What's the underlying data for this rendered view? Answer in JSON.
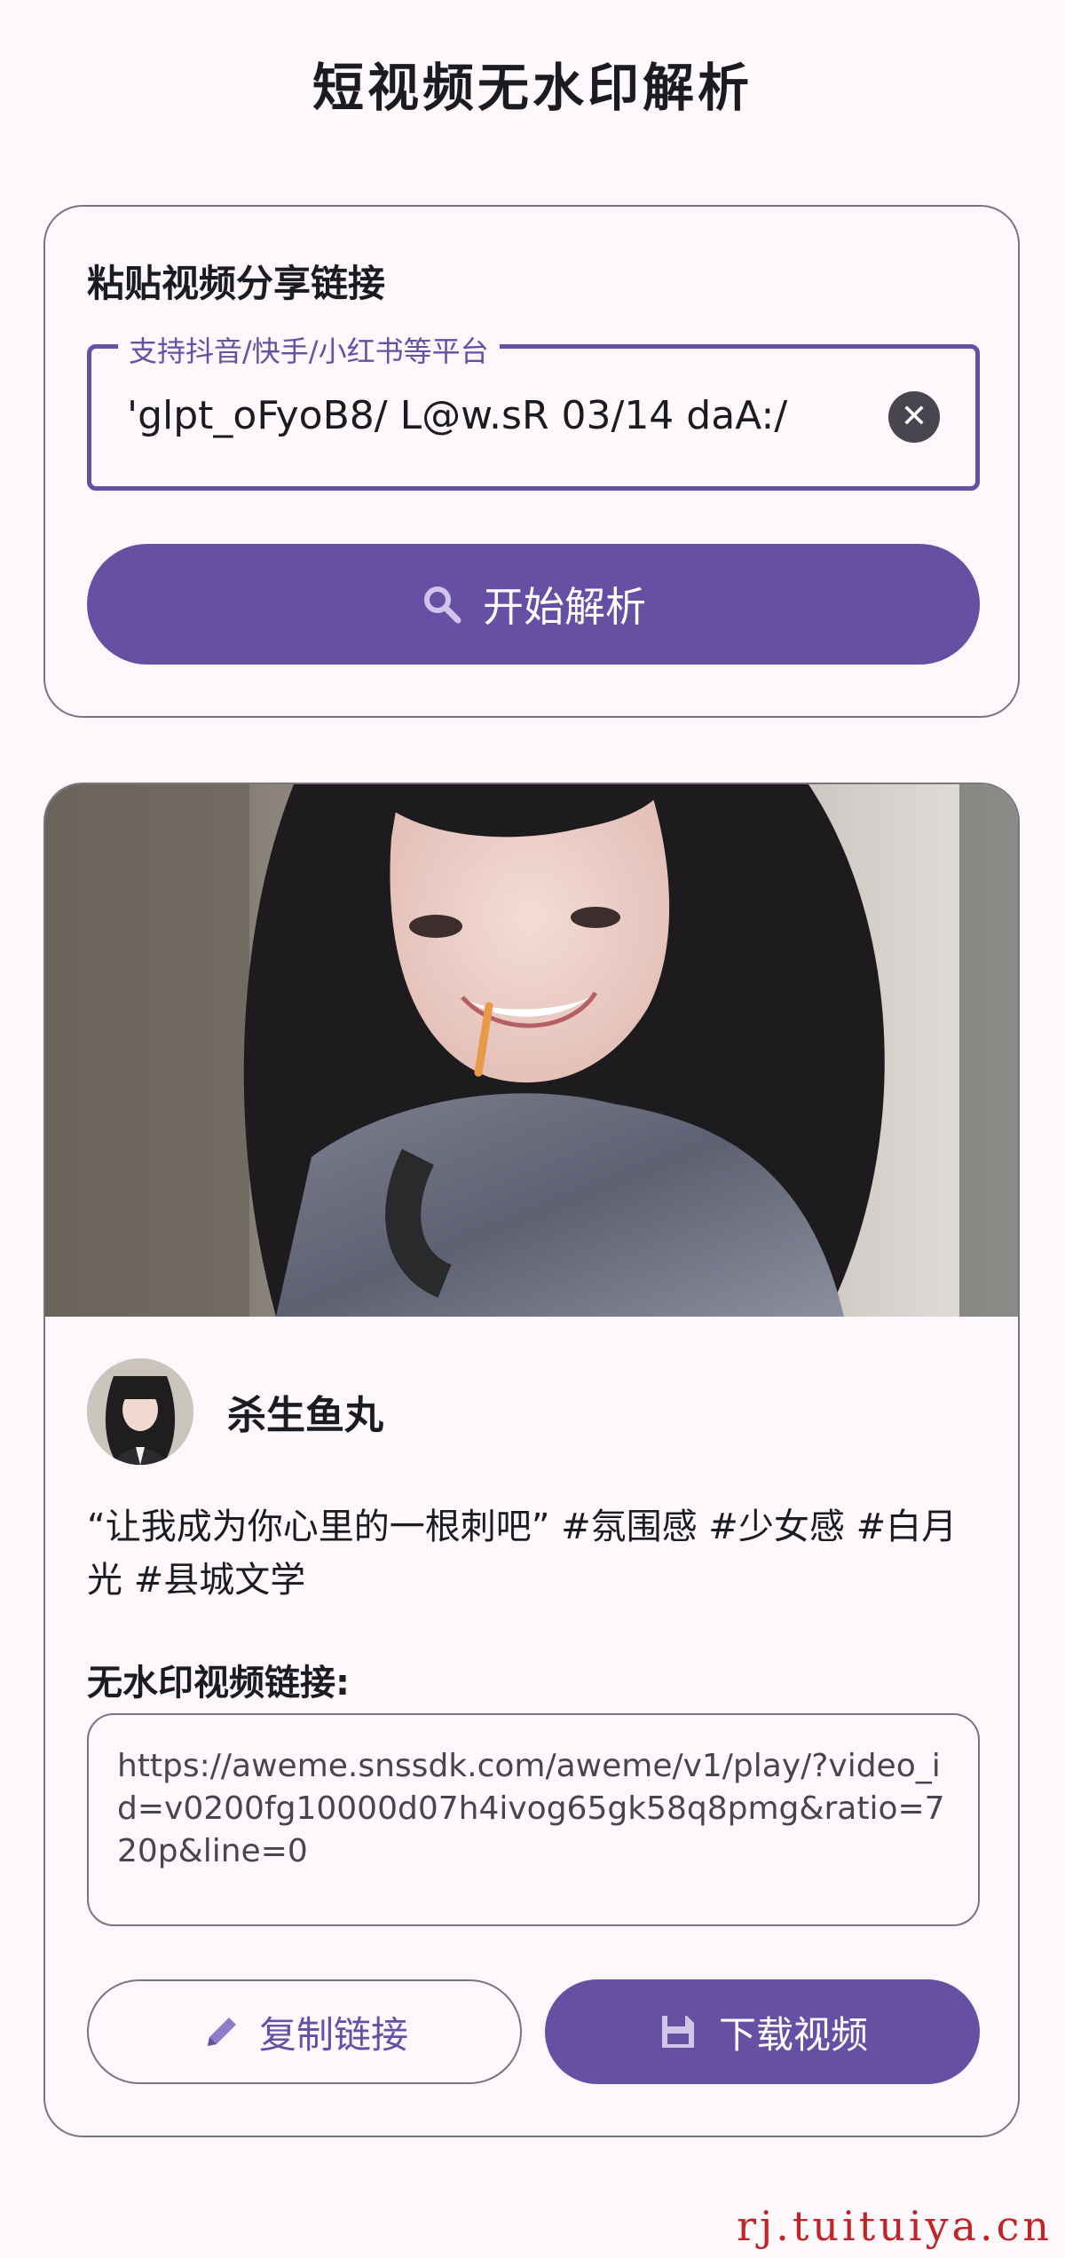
{
  "app": {
    "title": "短视频无水印解析"
  },
  "input_card": {
    "label": "粘贴视频分享链接",
    "field_label": "支持抖音/快手/小红书等平台",
    "field_value": "'glpt_oFyoB8/ L@w.sR 03/14 daA:/",
    "parse_button": "开始解析"
  },
  "result": {
    "author": "杀生鱼丸",
    "description": "“让我成为你心里的一根刺吧” #氛围感 #少女感 #白月光 #县城文学",
    "link_heading": "无水印视频链接:",
    "link": "https://aweme.snssdk.com/aweme/v1/play/?video_id=v0200fg10000d07h4ivog65gk58q8pmg&ratio=720p&line=0",
    "copy_button": "复制链接",
    "download_button": "下载视频"
  },
  "watermark": "rj.tuituiya.cn",
  "colors": {
    "accent": "#6750a4",
    "outline": "#79747e",
    "background": "#fdf8fc"
  },
  "icons": [
    "close-icon",
    "search-icon",
    "pencil-icon",
    "save-icon"
  ]
}
